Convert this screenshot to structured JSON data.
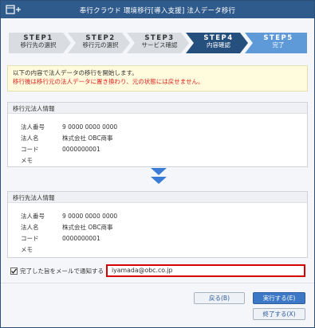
{
  "window": {
    "title": "奉行クラウド 環境移行[導入支援] 法人データ移行"
  },
  "steps": [
    {
      "num": "STEP1",
      "label": "移行先の選択",
      "state": "done"
    },
    {
      "num": "STEP2",
      "label": "移行元の選択",
      "state": "done"
    },
    {
      "num": "STEP3",
      "label": "サービス確認",
      "state": "done"
    },
    {
      "num": "STEP4",
      "label": "内容確認",
      "state": "current"
    },
    {
      "num": "STEP5",
      "label": "完了",
      "state": "future"
    }
  ],
  "notice": {
    "line1": "以下の内容で法人データの移行を開始します。",
    "line2": "移行後は移行元の法人データに置き換わり、元の状態には戻せません。"
  },
  "source": {
    "heading": "移行元法人情報",
    "fields": [
      {
        "key": "法人番号",
        "value": "9 0000 0000 0000"
      },
      {
        "key": "法人名",
        "value": "株式会社 OBC商事"
      },
      {
        "key": "コード",
        "value": "0000000001"
      },
      {
        "key": "メモ",
        "value": ""
      }
    ]
  },
  "target": {
    "heading": "移行先法人情報",
    "fields": [
      {
        "key": "法人番号",
        "value": "9 0000 0000 0000"
      },
      {
        "key": "法人名",
        "value": "株式会社 OBC商事"
      },
      {
        "key": "コード",
        "value": "0000000001"
      },
      {
        "key": "メモ",
        "value": ""
      }
    ]
  },
  "notify": {
    "label": "完了した旨をメールで通知する",
    "checked": true,
    "email": "iyamada@obc.co.jp"
  },
  "buttons": {
    "back": "戻る(B)",
    "execute": "実行する(E)",
    "close": "終了する(X)"
  },
  "colors": {
    "titlebar": "#2f5b8c",
    "step_done": "#d9dde2",
    "step_current": "#254f7d",
    "step_future": "#5f9ad8",
    "warning": "#e02020",
    "email_highlight": "#d40000"
  },
  "icons": {
    "app": "window-plus-icon",
    "arrow": "double-chevron-down-icon",
    "checkbox": "checkmark-icon"
  }
}
